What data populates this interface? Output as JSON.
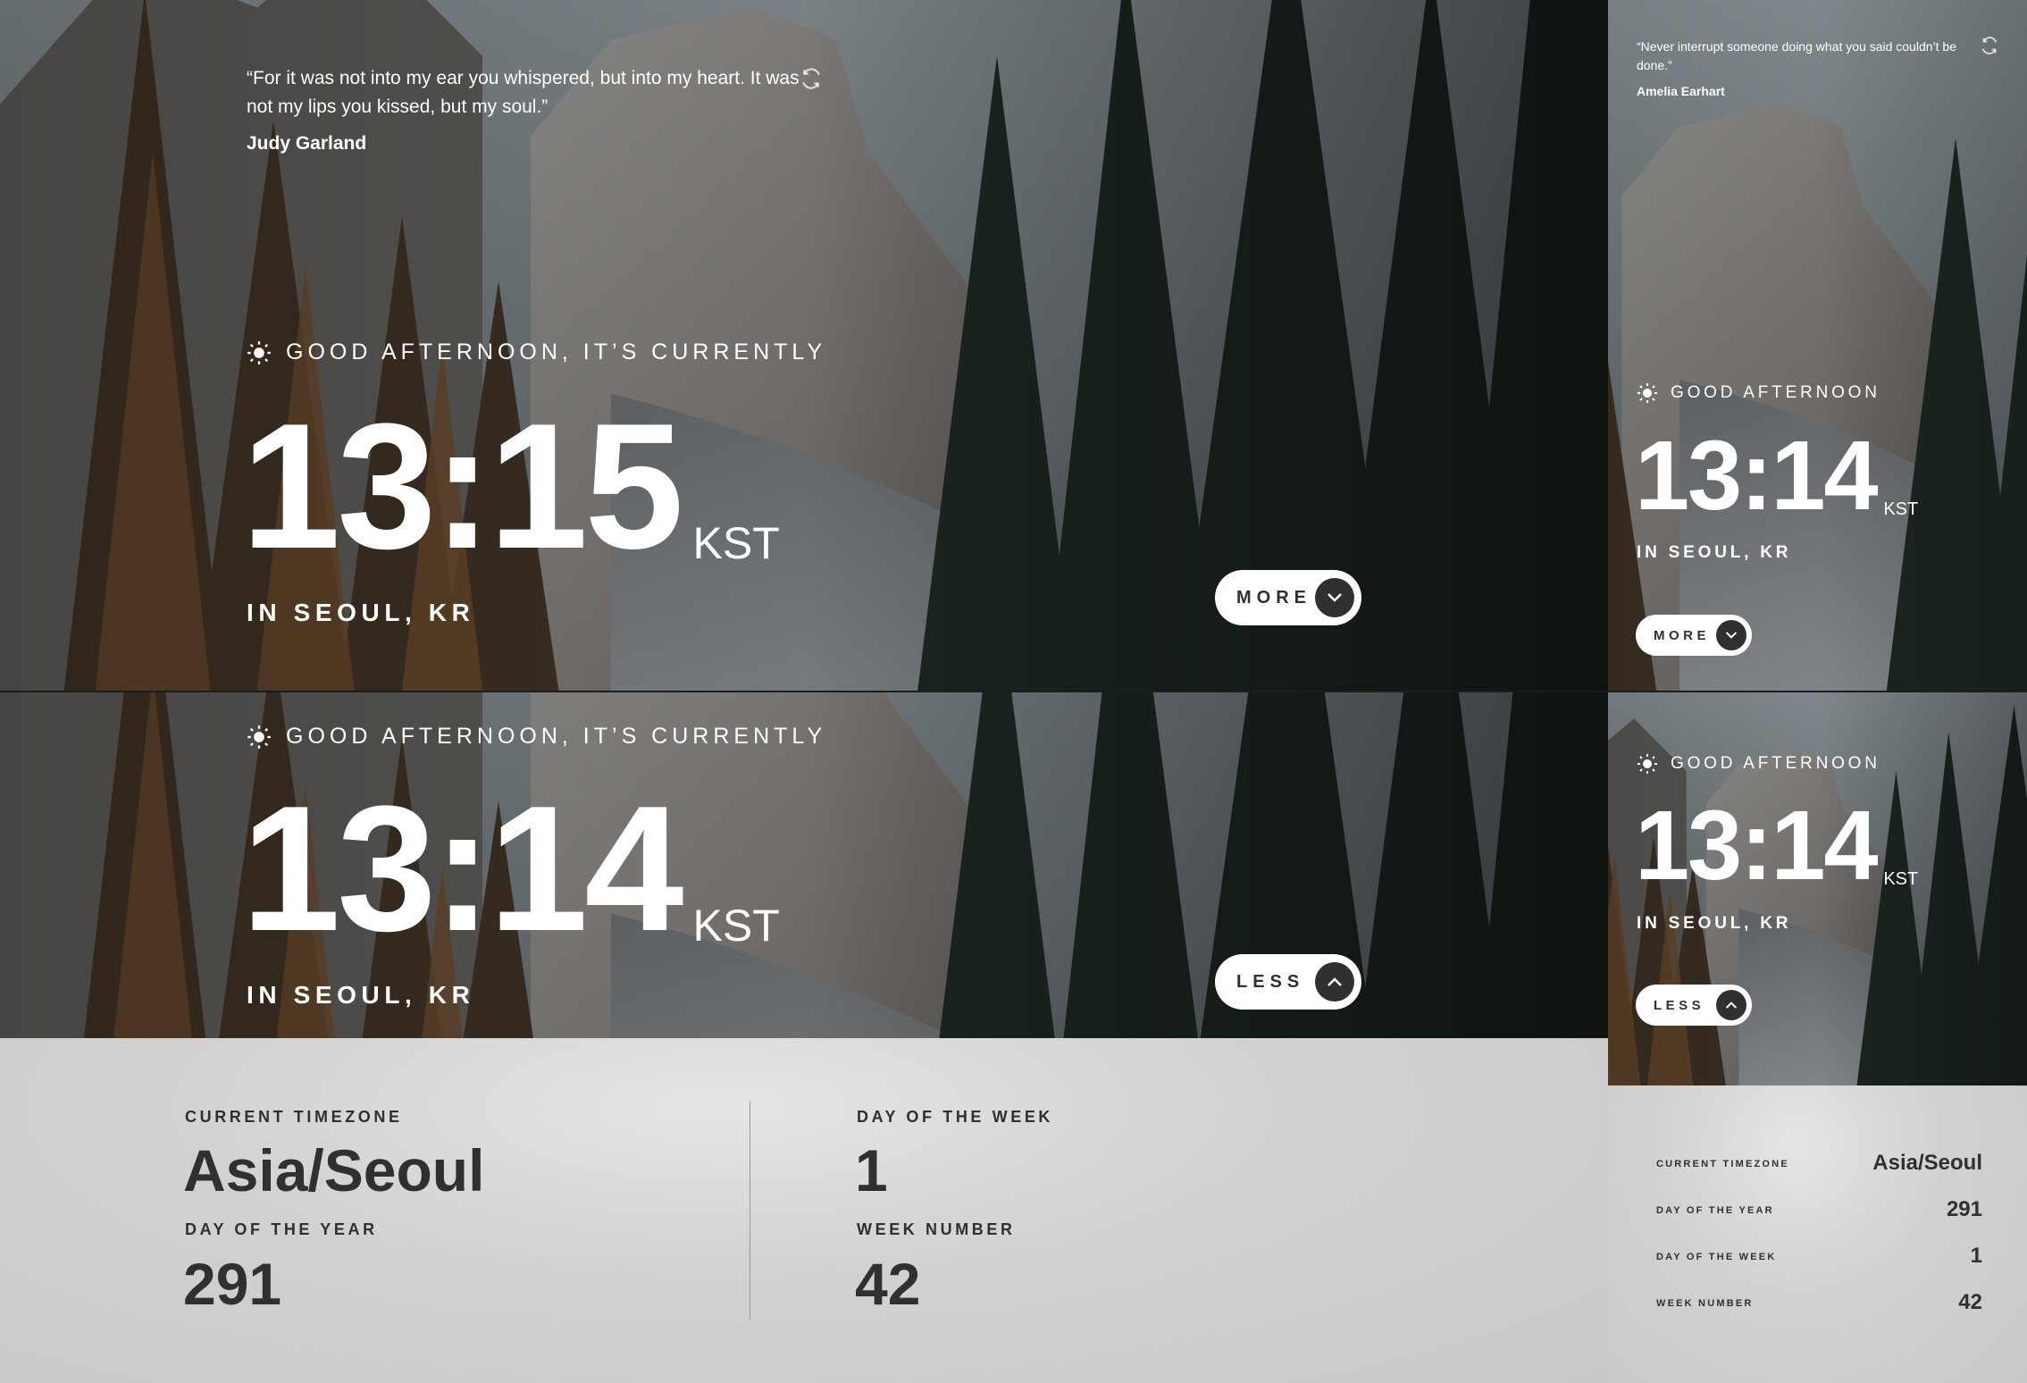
{
  "colors": {
    "button_bg": "#FFFFFF",
    "button_circle": "#303030",
    "text_dark": "#303030",
    "panel_bg": "#D2D1D0"
  },
  "views": {
    "desktop_collapsed": {
      "quote": "“For it was not into my ear you whispered, but into my heart. It was not my lips you kissed, but my soul.”",
      "author": "Judy Garland",
      "greeting": "GOOD AFTERNOON, IT’S CURRENTLY",
      "time": "13:15",
      "timezone": "KST",
      "location": "IN SEOUL, KR",
      "toggle_label": "MORE",
      "toggle_icon": "chevron-down-icon"
    },
    "mobile_collapsed": {
      "quote": "“Never interrupt someone doing what you said couldn’t be done.”",
      "author": "Amelia Earhart",
      "greeting": "GOOD AFTERNOON",
      "time": "13:14",
      "timezone": "KST",
      "location": "IN SEOUL, KR",
      "toggle_label": "MORE",
      "toggle_icon": "chevron-down-icon"
    },
    "desktop_expanded": {
      "greeting": "GOOD AFTERNOON, IT’S CURRENTLY",
      "time": "13:14",
      "timezone": "KST",
      "location": "IN SEOUL, KR",
      "toggle_label": "LESS",
      "toggle_icon": "chevron-up-icon",
      "info": {
        "timezone_label": "CURRENT TIMEZONE",
        "timezone_value": "Asia/Seoul",
        "day_of_year_label": "DAY OF THE YEAR",
        "day_of_year_value": "291",
        "day_of_week_label": "DAY OF THE WEEK",
        "day_of_week_value": "1",
        "week_number_label": "WEEK NUMBER",
        "week_number_value": "42"
      }
    },
    "mobile_expanded": {
      "greeting": "GOOD AFTERNOON",
      "time": "13:14",
      "timezone": "KST",
      "location": "IN SEOUL, KR",
      "toggle_label": "LESS",
      "toggle_icon": "chevron-up-icon",
      "info": {
        "timezone_label": "CURRENT TIMEZONE",
        "timezone_value": "Asia/Seoul",
        "day_of_year_label": "DAY OF THE YEAR",
        "day_of_year_value": "291",
        "day_of_week_label": "DAY OF THE WEEK",
        "day_of_week_value": "1",
        "week_number_label": "WEEK NUMBER",
        "week_number_value": "42"
      }
    }
  }
}
